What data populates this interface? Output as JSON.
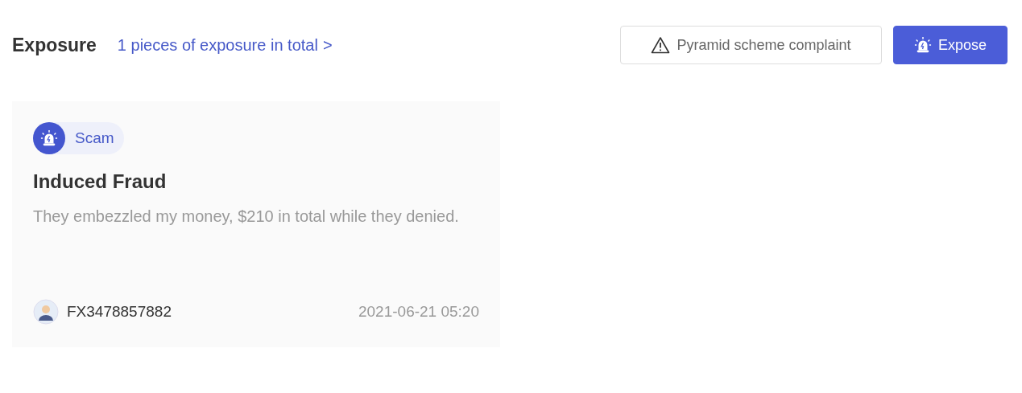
{
  "header": {
    "title": "Exposure",
    "summary_link": "1 pieces of exposure in total",
    "chevron": ">"
  },
  "buttons": [
    {
      "kind": "outline",
      "label": "Pyramid scheme complaint"
    },
    {
      "kind": "primary",
      "label": "Expose"
    }
  ],
  "cards": [
    {
      "tag": "Scam",
      "title": "Induced Fraud",
      "text": "They embezzled my money, $210 in total while they denied.",
      "user": "FX3478857882",
      "time": "2021-06-21 05:20"
    }
  ]
}
